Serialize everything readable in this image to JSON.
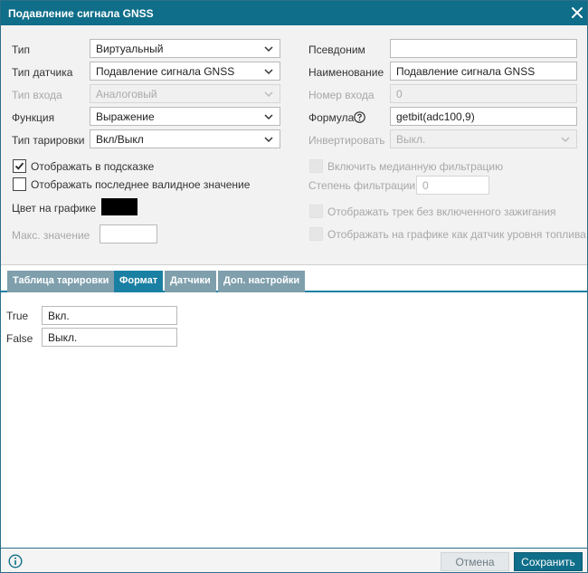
{
  "window": {
    "title": "Подавление сигнала GNSS"
  },
  "left": {
    "type_label": "Тип",
    "type_value": "Виртуальный",
    "sensor_type_label": "Тип датчика",
    "sensor_type_value": "Подавление сигнала GNSS",
    "input_type_label": "Тип входа",
    "input_type_value": "Аналоговый",
    "function_label": "Функция",
    "function_value": "Выражение",
    "calibration_type_label": "Тип тарировки",
    "calibration_type_value": "Вкл/Выкл",
    "show_in_tooltip_label": "Отображать в подсказке",
    "show_last_valid_label": "Отображать последнее валидное значение",
    "chart_color_label": "Цвет на графике",
    "max_value_label": "Макс. значение"
  },
  "right": {
    "alias_label": "Псевдоним",
    "alias_value": "",
    "name_label": "Наименование",
    "name_value": "Подавление сигнала GNSS",
    "input_number_label": "Номер входа",
    "input_number_value": "0",
    "formula_label": "Формула",
    "formula_value": "getbit(adc100,9)",
    "invert_label": "Инвертировать",
    "invert_value": "Выкл.",
    "median_filter_label": "Включить медианную фильтрацию",
    "filter_degree_label": "Степень фильтрации",
    "filter_degree_value": "0",
    "track_without_ignition_label": "Отображать трек без включенного зажигания",
    "show_as_fuel_sensor_label": "Отображать на графике как датчик уровня топлива"
  },
  "tabs": [
    {
      "label": "Таблица тарировки"
    },
    {
      "label": "Формат"
    },
    {
      "label": "Датчики"
    },
    {
      "label": "Доп. настройки"
    }
  ],
  "format": {
    "true_label": "True",
    "true_value": "Вкл.",
    "false_label": "False",
    "false_value": "Выкл."
  },
  "footer": {
    "cancel_label": "Отмена",
    "save_label": "Сохранить"
  },
  "colors": {
    "titlebar": "#0f6e89",
    "tab_active": "#1a80a3",
    "tab_inactive": "#7f9fac",
    "chart_color": "#000000"
  },
  "state": {
    "show_in_tooltip_checked": true,
    "show_last_valid_checked": false,
    "active_tab": "Формат"
  }
}
